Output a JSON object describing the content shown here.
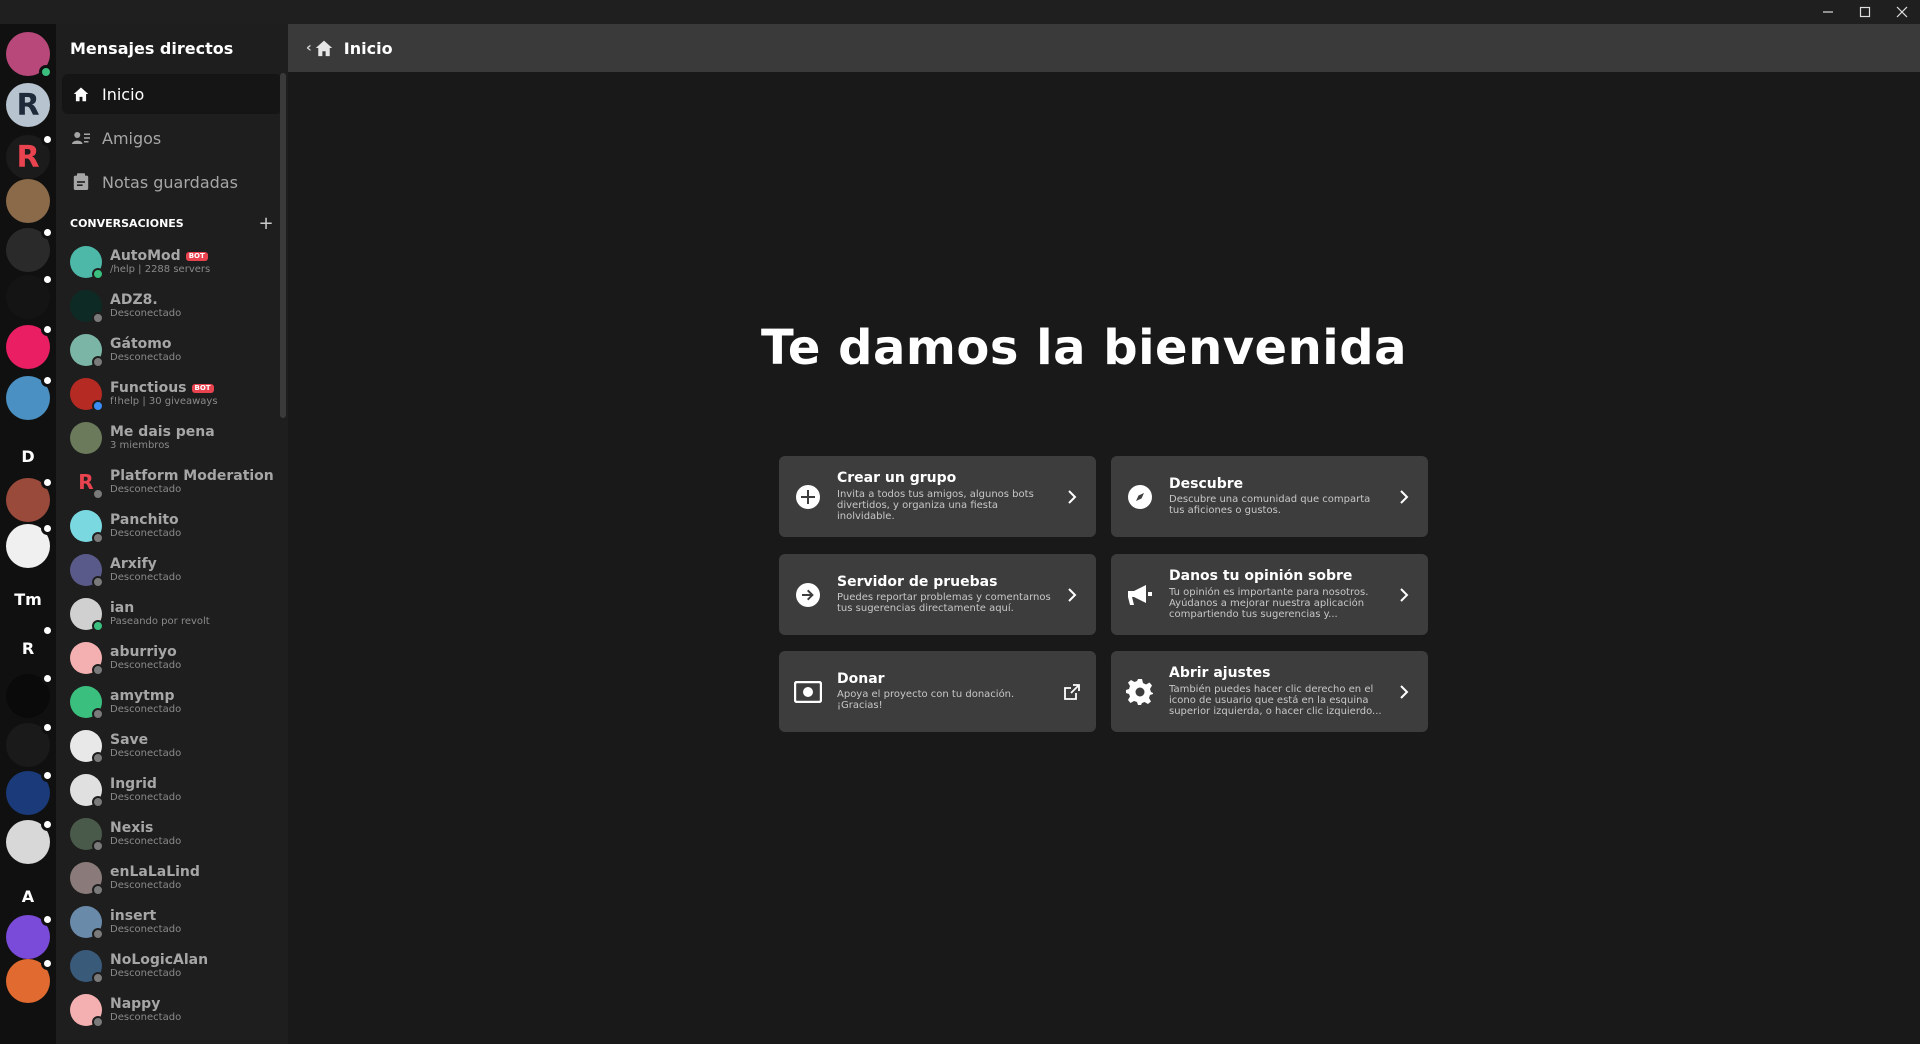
{
  "window": {
    "minimize": "–",
    "maximize": "□",
    "close": "✕"
  },
  "rail": [
    {
      "name": "user-avatar",
      "color": "#b8487a",
      "text": "",
      "online": true
    },
    {
      "name": "server-r-blue",
      "color": "#b7c3cf",
      "text": "R",
      "textColor": "#1e2a3a"
    },
    {
      "name": "server-r-red",
      "color": "#1b1b1b",
      "text": "R",
      "textColor": "#e9434f",
      "dot": true
    },
    {
      "name": "server-crate",
      "color": "#8a6a48",
      "text": ""
    },
    {
      "name": "server-pink-wrench",
      "color": "#2a2a2a",
      "text": "",
      "dot": true
    },
    {
      "name": "server-creeper",
      "color": "#141414",
      "text": "",
      "dot": true
    },
    {
      "name": "server-fingerprint",
      "color": "#e91e63",
      "text": "",
      "dot": true
    },
    {
      "name": "server-pepe",
      "color": "#4a90c2",
      "text": "",
      "dot": true
    },
    {
      "name": "server-d",
      "color": "transparent",
      "text": "D"
    },
    {
      "name": "server-paint",
      "color": "#9a4a3a",
      "text": "",
      "dot": true
    },
    {
      "name": "server-target",
      "color": "#f0f0f0",
      "text": "",
      "dot": true
    },
    {
      "name": "server-tm",
      "color": "transparent",
      "text": "Tm"
    },
    {
      "name": "server-r",
      "color": "transparent",
      "text": "R",
      "dot": true
    },
    {
      "name": "server-gold",
      "color": "#0a0a0a",
      "text": "",
      "dot": true
    },
    {
      "name": "server-red-bird",
      "color": "#1a1a1a",
      "text": "",
      "dot": true
    },
    {
      "name": "server-earth",
      "color": "#1a3a7a",
      "text": "",
      "dot": true
    },
    {
      "name": "server-anime",
      "color": "#d8d8d8",
      "text": "",
      "dot": true
    },
    {
      "name": "server-a",
      "color": "transparent",
      "text": "A"
    },
    {
      "name": "server-bot-purple",
      "color": "#7a4ad8",
      "text": "",
      "dot": true
    },
    {
      "name": "server-orange",
      "color": "#e06a30",
      "text": "",
      "dot": true
    }
  ],
  "sidebar": {
    "title": "Mensajes directos",
    "nav": [
      {
        "label": "Inicio",
        "icon": "home-icon",
        "active": true
      },
      {
        "label": "Amigos",
        "icon": "friends-icon"
      },
      {
        "label": "Notas guardadas",
        "icon": "notes-icon"
      }
    ],
    "conversations_header": "CONVERSACIONES",
    "add": "+",
    "conversations": [
      {
        "name": "AutoMod",
        "sub": "/help | 2288 servers",
        "bot": "BOT",
        "status": "on",
        "color": "#4db8a8"
      },
      {
        "name": "ADZ8.",
        "sub": "Desconectado",
        "status": "off",
        "color": "#0d2b24"
      },
      {
        "name": "Gátomo",
        "sub": "Desconectado",
        "status": "off",
        "color": "#7ab5a5"
      },
      {
        "name": "Functious",
        "sub": "f!help | 30 giveaways",
        "bot": "BOT",
        "status": "idle",
        "color": "#b52a22"
      },
      {
        "name": "Me dais pena",
        "sub": "3 miembros",
        "status": "none",
        "color": "#6a7a5a"
      },
      {
        "name": "Platform Moderation",
        "sub": "Desconectado",
        "status": "off",
        "color": "#1e1e1e",
        "letter": "R"
      },
      {
        "name": "Panchito",
        "sub": "Desconectado",
        "status": "off",
        "color": "#7ad8e0"
      },
      {
        "name": "Arxify",
        "sub": "Desconectado",
        "status": "off",
        "color": "#5a5a8a"
      },
      {
        "name": "ian",
        "sub": "Paseando por revolt",
        "status": "on",
        "color": "#d0d0d0"
      },
      {
        "name": "aburriyo",
        "sub": "Desconectado",
        "status": "off",
        "color": "#f4b0b0"
      },
      {
        "name": "amytmp",
        "sub": "Desconectado",
        "status": "off",
        "color": "#3abf7e"
      },
      {
        "name": "Save",
        "sub": "Desconectado",
        "status": "off",
        "color": "#e8e8e8"
      },
      {
        "name": "Ingrid",
        "sub": "Desconectado",
        "status": "off",
        "color": "#e0e0e0"
      },
      {
        "name": "Nexis",
        "sub": "Desconectado",
        "status": "off",
        "color": "#4a5a4a"
      },
      {
        "name": "enLaLaLind",
        "sub": "Desconectado",
        "status": "off",
        "color": "#8a7a7a"
      },
      {
        "name": "insert",
        "sub": "Desconectado",
        "status": "off",
        "color": "#6a8aaa"
      },
      {
        "name": "NoLogicAlan",
        "sub": "Desconectado",
        "status": "off",
        "color": "#3a5a7a"
      },
      {
        "name": "Nappy",
        "sub": "Desconectado",
        "status": "off",
        "color": "#f4b0b0"
      }
    ]
  },
  "header": {
    "back": "‹",
    "title": "Inicio"
  },
  "welcome": "Te damos la bienvenida",
  "cards": [
    {
      "name": "create-group-card",
      "icon": "plus-circle-icon",
      "title": "Crear un grupo",
      "desc": "Invita a todos tus amigos, algunos bots divertidos, y organiza una fiesta inolvidable.",
      "arrow": "chevron-right-icon"
    },
    {
      "name": "discover-card",
      "icon": "compass-icon",
      "title": "Descubre",
      "desc": "Descubre una comunidad que comparta tus aficiones o gustos.",
      "arrow": "chevron-right-icon"
    },
    {
      "name": "testing-server-card",
      "icon": "arrow-right-circle-icon",
      "title": "Servidor de pruebas",
      "desc": "Puedes reportar problemas y comentarnos tus sugerencias directamente aquí.",
      "arrow": "chevron-right-icon"
    },
    {
      "name": "feedback-card",
      "icon": "megaphone-icon",
      "title": "Danos tu opinión sobre",
      "desc": "Tu opinión es importante para nosotros. Ayúdanos a mejorar nuestra aplicación compartiendo tus sugerencias y...",
      "arrow": "chevron-right-icon"
    },
    {
      "name": "donate-card",
      "icon": "money-icon",
      "title": "Donar",
      "desc": "Apoya el proyecto con tu donación. ¡Gracias!",
      "arrow": "external-link-icon"
    },
    {
      "name": "settings-card",
      "icon": "gear-icon",
      "title": "Abrir ajustes",
      "desc": "También puedes hacer clic derecho en el icono de usuario que está en la esquina superior izquierda, o hacer clic izquierdo...",
      "arrow": "chevron-right-icon"
    }
  ]
}
